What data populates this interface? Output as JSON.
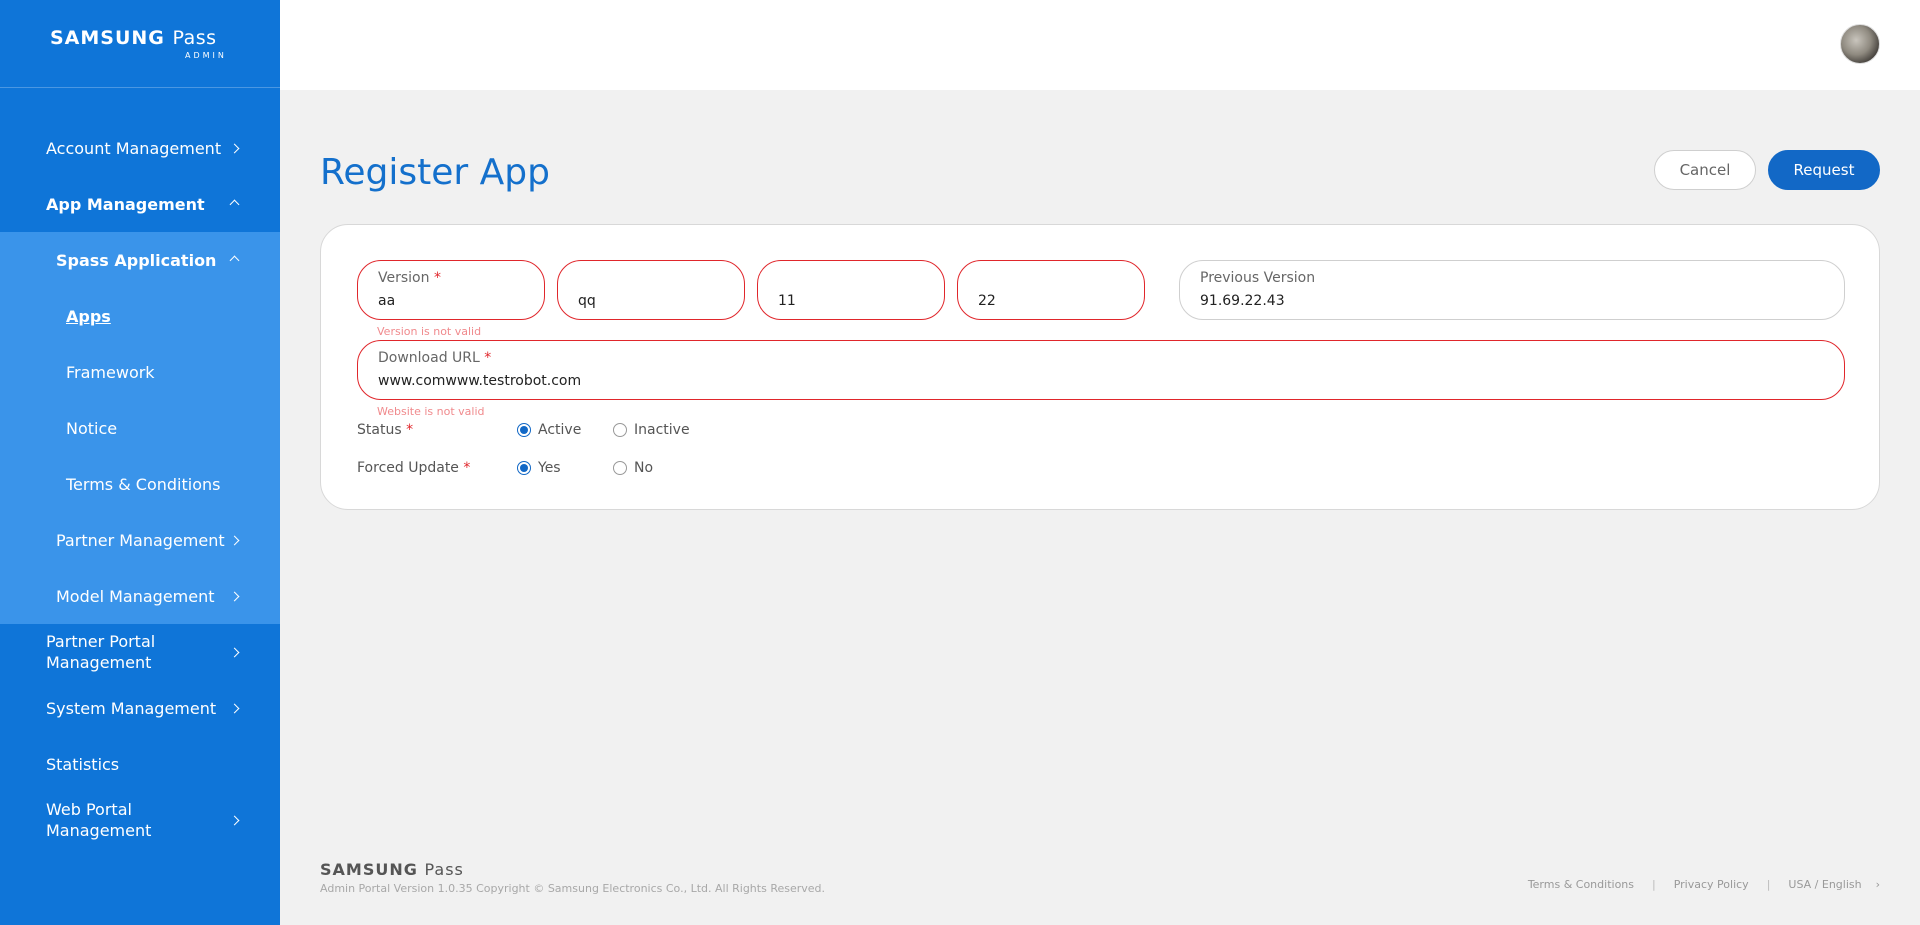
{
  "brand": {
    "logo_main": "SAMSUNG",
    "logo_pass": "Pass",
    "logo_sub": "ADMIN"
  },
  "sidebar": {
    "items": [
      {
        "label": "Account Management"
      },
      {
        "label": "App Management"
      },
      {
        "label": "Spass Application"
      },
      {
        "label": "Apps"
      },
      {
        "label": "Framework"
      },
      {
        "label": "Notice"
      },
      {
        "label": "Terms & Conditions"
      },
      {
        "label": "Partner Management"
      },
      {
        "label": "Model Management"
      },
      {
        "label": "Partner Portal Management"
      },
      {
        "label": "System Management"
      },
      {
        "label": "Statistics"
      },
      {
        "label": "Web Portal Management"
      }
    ]
  },
  "page": {
    "title": "Register App",
    "cancel_label": "Cancel",
    "request_label": "Request"
  },
  "form": {
    "version_label": "Version",
    "req_mark": "*",
    "version_1": "aa",
    "version_2": "qq",
    "version_3": "11",
    "version_4": "22",
    "version_error": "Version is not valid",
    "previous_version_label": "Previous Version",
    "previous_version_value": "91.69.22.43",
    "download_url_label": "Download URL",
    "download_url_value": "www.comwww.testrobot.com",
    "download_url_error": "Website is not valid",
    "status_label": "Status",
    "status_options": [
      "Active",
      "Inactive"
    ],
    "status_selected": "Active",
    "forced_update_label": "Forced Update",
    "forced_update_options": [
      "Yes",
      "No"
    ],
    "forced_update_selected": "Yes"
  },
  "footer": {
    "logo_main": "SAMSUNG",
    "logo_pass": "Pass",
    "copyright": "Admin Portal Version 1.0.35 Copyright © Samsung Electronics Co., Ltd. All Rights Reserved.",
    "links": [
      "Terms & Conditions",
      "Privacy Policy",
      "USA / English"
    ],
    "separator": "|",
    "arrow": "›"
  },
  "colors": {
    "sidebar": "#0f75d8",
    "sidebar_sub": "#3a94ea",
    "accent": "#1268c6",
    "error": "#e0262b",
    "title": "#1470cc"
  }
}
